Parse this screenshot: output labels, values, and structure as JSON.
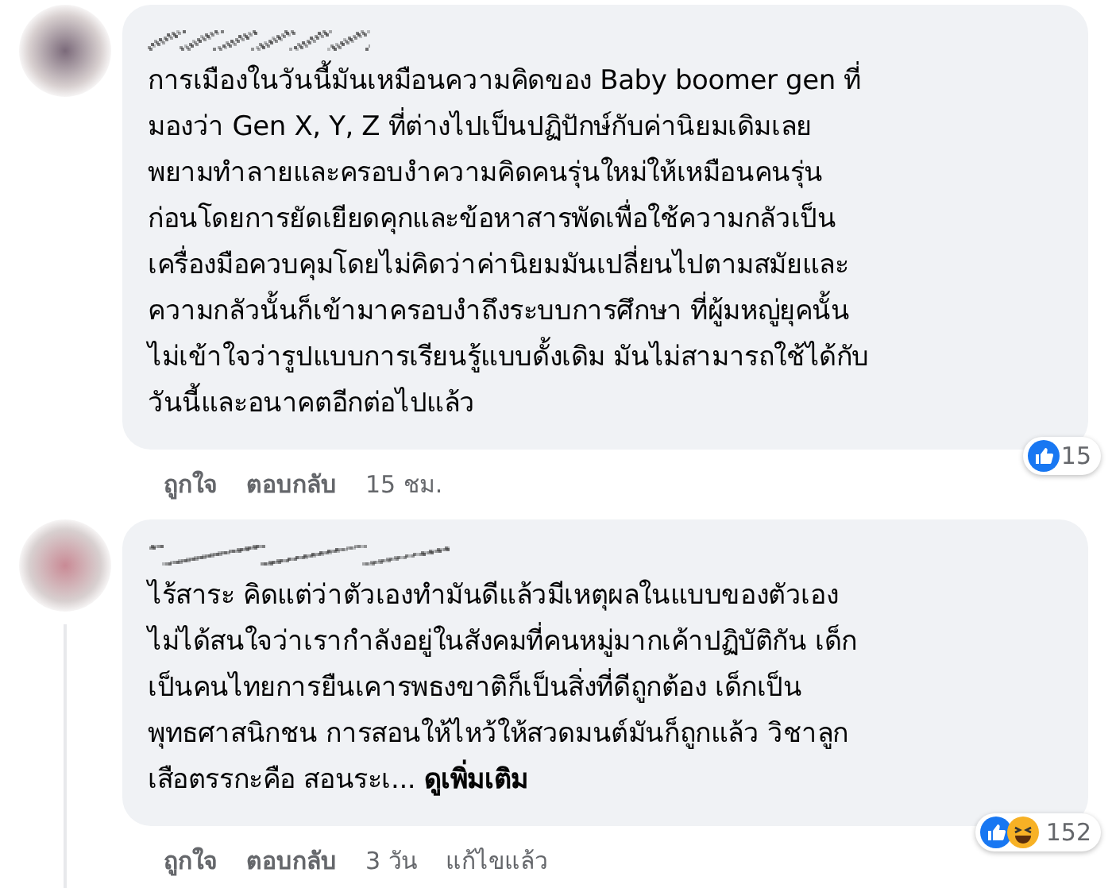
{
  "comments": [
    {
      "lines": [
        "การเมืองในวันนี้มันเหมือนความคิดของ Baby boomer gen ที่",
        "มองว่า Gen X, Y, Z ที่ต่างไปเป็นปฏิปักษ์กับค่านิยมเดิมเลย",
        "พยามทำลายและครอบงำความคิดคนรุ่นใหม่ให้เหมือนคนรุ่น",
        "ก่อนโดยการยัดเยียดคุกและข้อหาสารพัดเพื่อใช้ความกลัวเป็น",
        "เครื่องมือควบคุมโดยไม่คิดว่าค่านิยมมันเปลี่ยนไปตามสมัยและ",
        "ความกลัวนั้นก็เข้ามาครอบงำถึงระบบการศึกษา ที่ผู้มหญู่ยุคนั้น",
        "ไม่เข้าใจว่ารูปแบบการเรียนรู้แบบดั้งเดิม มันไม่สามารถใช้ได้กับ",
        "วันนี้และอนาคตอีกต่อไปแล้ว"
      ],
      "reactions": [
        {
          "kind": "like"
        }
      ],
      "reaction_count": "15",
      "actions": [
        {
          "kind": "link",
          "label": "ถูกใจ"
        },
        {
          "kind": "link",
          "label": "ตอบกลับ"
        },
        {
          "kind": "meta",
          "label": "15 ชม."
        }
      ]
    },
    {
      "lines": [
        "ไร้สาระ คิดแต่ว่าตัวเองทำมันดีแล้วมีเหตุผลในแบบของตัวเอง",
        "ไม่ได้สนใจว่าเรากำลังอยู่ในสังคมที่คนหมู่มากเค้าปฏิบัติกัน เด็ก",
        "เป็นคนไทยการยืนเคารพธงขาติก็เป็นสิ่งที่ดีถูกต้อง เด็กเป็น",
        "พุทธศาสนิกชน การสอนให้ไหว้ให้สวดมนต์มันก็ถูกแล้ว วิชาลูก",
        "เสือตรรกะคือ สอนระเ..."
      ],
      "see_more": "ดูเพิ่มเติม",
      "reactions": [
        {
          "kind": "like"
        },
        {
          "kind": "haha"
        }
      ],
      "reaction_count": "152",
      "actions": [
        {
          "kind": "link",
          "label": "ถูกใจ"
        },
        {
          "kind": "link",
          "label": "ตอบกลับ"
        },
        {
          "kind": "meta",
          "label": "3 วัน"
        },
        {
          "kind": "meta",
          "label": "แก้ไขแล้ว"
        }
      ]
    }
  ]
}
